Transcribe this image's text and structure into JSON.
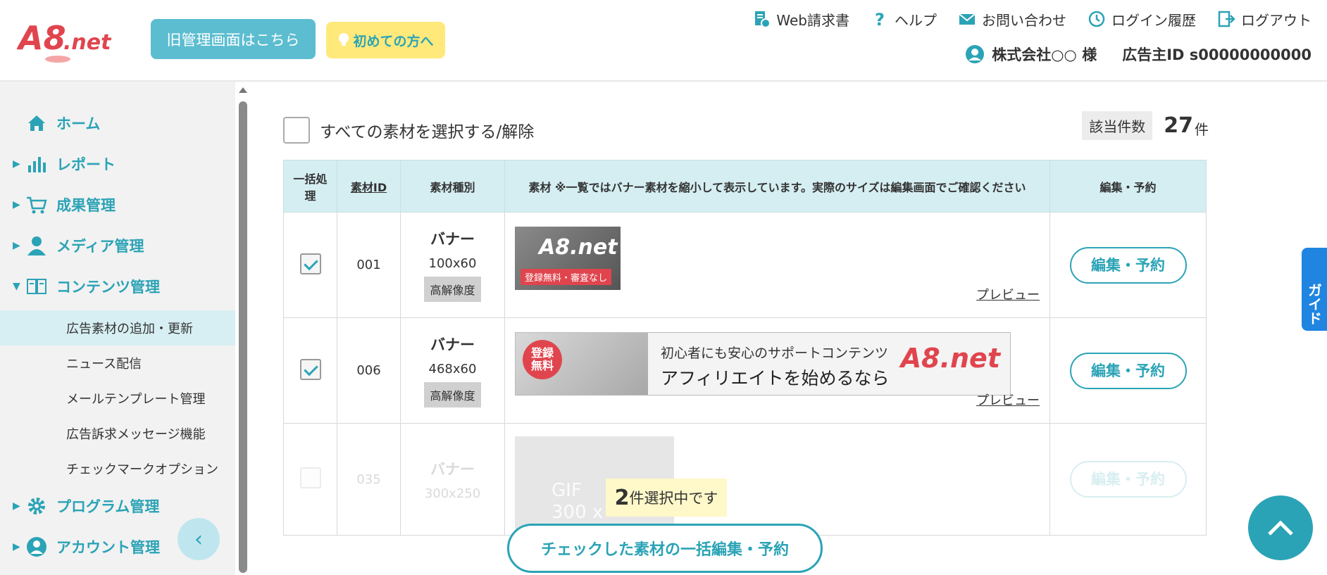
{
  "header": {
    "logo_text": "A8.net",
    "old_admin_button": "旧管理画面はこちら",
    "first_time_button": "初めての方へ",
    "nav": [
      {
        "label": "Web請求書",
        "icon": "invoice-icon"
      },
      {
        "label": "ヘルプ",
        "icon": "help-icon"
      },
      {
        "label": "お問い合わせ",
        "icon": "mail-icon"
      },
      {
        "label": "ログイン履歴",
        "icon": "history-icon"
      },
      {
        "label": "ログアウト",
        "icon": "logout-icon"
      }
    ],
    "company": "株式会社○○ 様",
    "advertiser_id": "広告主ID s00000000000"
  },
  "sidebar": {
    "items": [
      {
        "label": "ホーム",
        "icon": "home-icon"
      },
      {
        "label": "レポート",
        "icon": "report-icon"
      },
      {
        "label": "成果管理",
        "icon": "cart-icon"
      },
      {
        "label": "メディア管理",
        "icon": "person-icon"
      },
      {
        "label": "コンテンツ管理",
        "icon": "book-icon"
      }
    ],
    "sub_items": [
      "広告素材の追加・更新",
      "ニュース配信",
      "メールテンプレート管理",
      "広告訴求メッセージ機能",
      "チェックマークオプション"
    ],
    "bottom_items": [
      {
        "label": "プログラム管理",
        "icon": "gear-icon"
      },
      {
        "label": "アカウント管理",
        "icon": "account-icon"
      }
    ]
  },
  "main": {
    "select_all_label": "すべての素材を選択する/解除",
    "count_label": "該当件数",
    "count_value": "27",
    "count_unit": "件",
    "table": {
      "headers": {
        "bulk": "一括処理",
        "id": "素材ID",
        "type": "素材種別",
        "material": "素材 ※一覧ではバナー素材を縮小して表示しています。実際のサイズは編集画面でご確認ください",
        "edit": "編集・予約"
      },
      "rows": [
        {
          "id": "001",
          "type": "バナー",
          "size": "100x60",
          "hires": "高解像度",
          "checked": true,
          "preview": "プレビュー",
          "edit": "編集・予約",
          "banner_logo": "A8.net",
          "banner_tag": "登録無料・審査なし"
        },
        {
          "id": "006",
          "type": "バナー",
          "size": "468x60",
          "hires": "高解像度",
          "checked": true,
          "preview": "プレビュー",
          "edit": "編集・予約",
          "banner_badge_1": "登録",
          "banner_badge_2": "無料",
          "banner_text_1": "初心者にも安心のサポートコンテンツ",
          "banner_text_2": "アフィリエイトを始めるなら",
          "banner_logo": "A8.net"
        },
        {
          "id": "035",
          "type": "バナー",
          "size": "300x250",
          "checked": false,
          "edit": "編集・予約",
          "placeholder_1": "GIF",
          "placeholder_2": "300 x"
        }
      ]
    }
  },
  "floating": {
    "selected_count": "2",
    "selected_text": "件選択中です",
    "bulk_button": "チェックした素材の一括編集・予約",
    "guide_tab": "ガイド"
  },
  "colors": {
    "accent": "#2ba3b6",
    "header_cell": "#d5eef2",
    "sidebar_bg": "#f2f2f2",
    "guide": "#1f85e0"
  }
}
